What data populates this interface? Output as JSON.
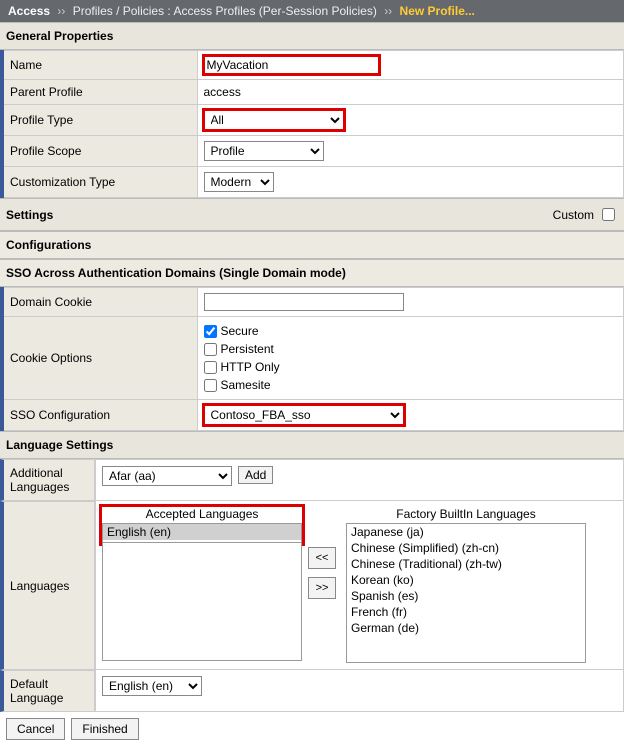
{
  "breadcrumb": {
    "seg1": "Access",
    "seg2": "Profiles / Policies : Access Profiles (Per-Session Policies)",
    "current": "New Profile..."
  },
  "sections": {
    "general": "General Properties",
    "settings": "Settings",
    "configurations": "Configurations",
    "sso": "SSO Across Authentication Domains (Single Domain mode)",
    "language": "Language Settings"
  },
  "labels": {
    "name": "Name",
    "parent_profile": "Parent Profile",
    "profile_type": "Profile Type",
    "profile_scope": "Profile Scope",
    "customization_type": "Customization Type",
    "custom": "Custom",
    "domain_cookie": "Domain Cookie",
    "cookie_options": "Cookie Options",
    "sso_config": "SSO Configuration",
    "additional_languages": "Additional Languages",
    "languages": "Languages",
    "default_language": "Default Language",
    "accepted_languages": "Accepted Languages",
    "factory_languages": "Factory BuiltIn Languages",
    "add": "Add",
    "arrow_left": "<<",
    "arrow_right": ">>",
    "cancel": "Cancel",
    "finished": "Finished"
  },
  "values": {
    "name": "MyVacation",
    "parent_profile": "access",
    "profile_type": "All",
    "profile_scope": "Profile",
    "customization_type": "Modern",
    "domain_cookie": "",
    "sso_config": "Contoso_FBA_sso",
    "additional_language": "Afar (aa)",
    "default_language": "English (en)"
  },
  "cookie_options": {
    "secure": {
      "label": "Secure",
      "checked": true
    },
    "persistent": {
      "label": "Persistent",
      "checked": false
    },
    "http_only": {
      "label": "HTTP Only",
      "checked": false
    },
    "samesite": {
      "label": "Samesite",
      "checked": false
    }
  },
  "accepted_languages": [
    "English (en)"
  ],
  "factory_languages": [
    "Japanese (ja)",
    "Chinese (Simplified) (zh-cn)",
    "Chinese (Traditional) (zh-tw)",
    "Korean (ko)",
    "Spanish (es)",
    "French (fr)",
    "German (de)"
  ]
}
